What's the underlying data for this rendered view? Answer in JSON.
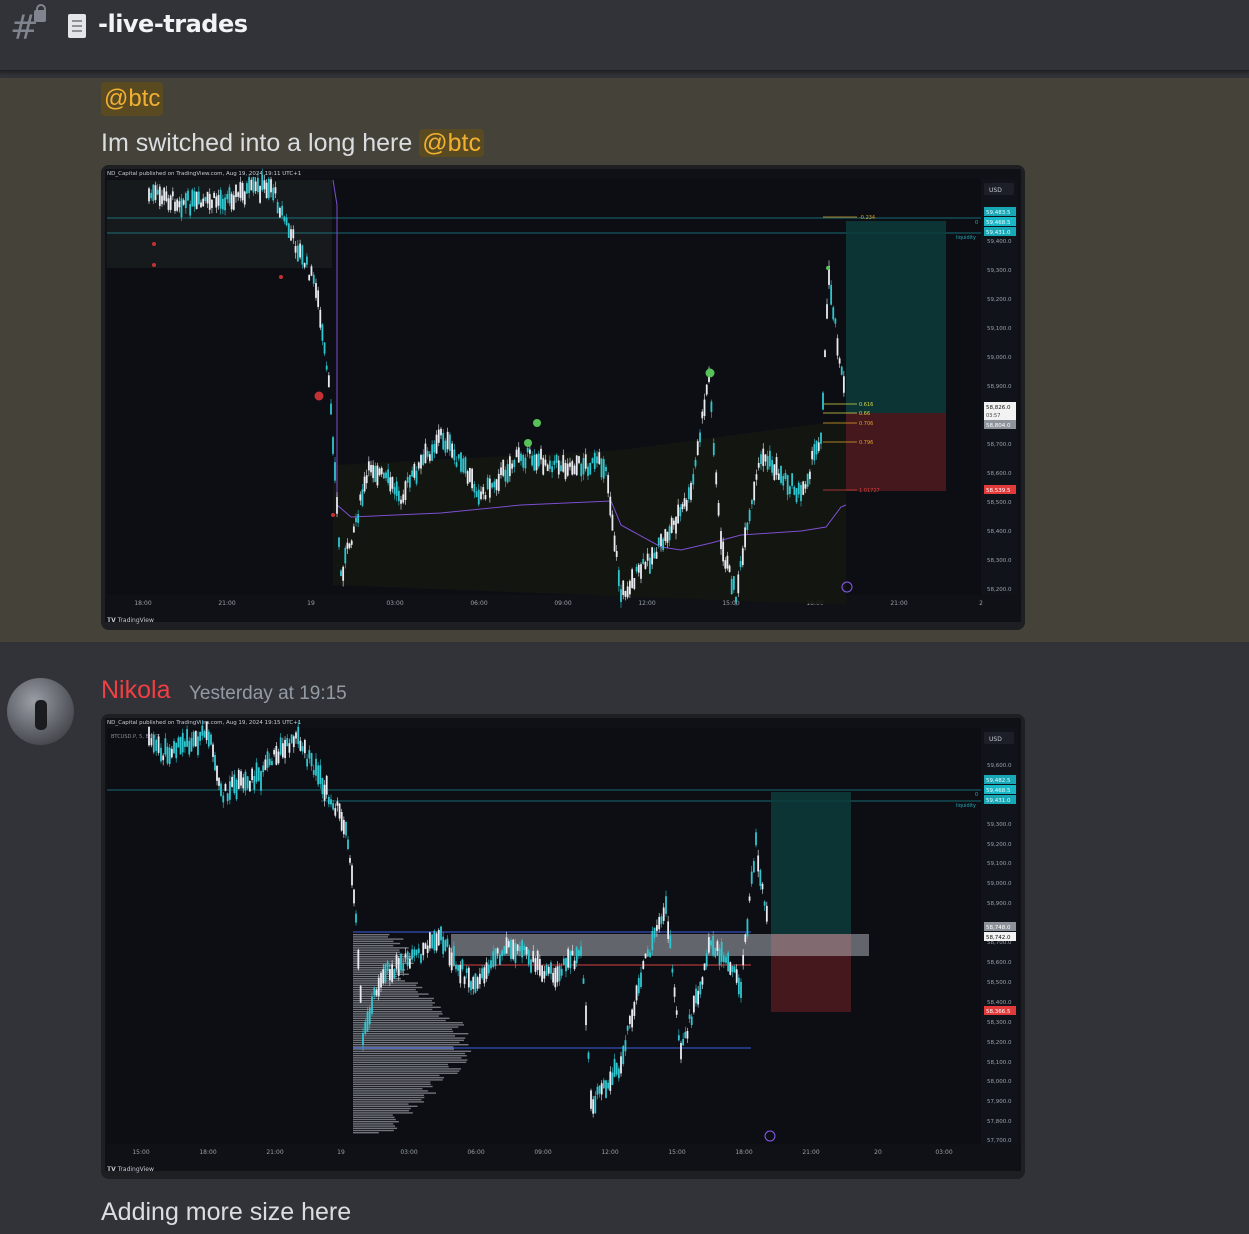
{
  "channel": {
    "name": "-live-trades",
    "hash_icon": "hash-lock-icon",
    "doc_icon": "document-icon"
  },
  "messages": [
    {
      "mention_line": "@btc",
      "text": "Im switched into a long here ",
      "inline_mention": "@btc",
      "highlight_color": "#45423a",
      "chart": {
        "publisher": "ND_Capital published on TradingView.com, Aug 19, 2024 19:11 UTC+1",
        "symbol": "BTCUSD.P, 5, BYBIT",
        "currency": "USD",
        "brand": "TradingView",
        "time_labels": [
          "18:00",
          "21:00",
          "19",
          "03:00",
          "06:00",
          "09:00",
          "12:00",
          "15:00",
          "18:00",
          "21:00",
          "2"
        ],
        "price_labels": [
          "59,400.0",
          "59,300.0",
          "59,200.0",
          "59,100.0",
          "59,000.0",
          "58,900.0",
          "58,700.0",
          "58,600.0",
          "58,500.0",
          "58,400.0",
          "58,300.0",
          "58,200.0"
        ],
        "price_tags": {
          "top1": "59,483.5",
          "top2": "59,468.5",
          "top3": "59,431.0",
          "current": "58,826.0",
          "countdown": "03:57",
          "below": "58,804.0",
          "stop": "58,539.5"
        },
        "liquidity_label": "liquidity",
        "zero_label": "0",
        "fib_levels": [
          "-0.234",
          "0.616",
          "0.66",
          "0.706",
          "0.796",
          "1.01727"
        ]
      }
    },
    {
      "author": "Nikola",
      "author_color": "#f23f43",
      "timestamp": "Yesterday at 19:15",
      "chart": {
        "publisher": "ND_Capital published on TradingView.com, Aug 19, 2024 19:15 UTC+1",
        "symbol": "BTCUSD.P, 5, BYBIT",
        "currency": "USD",
        "brand": "TradingView",
        "time_labels": [
          "15:00",
          "18:00",
          "21:00",
          "19",
          "03:00",
          "06:00",
          "09:00",
          "12:00",
          "15:00",
          "18:00",
          "21:00",
          "20",
          "03:00"
        ],
        "price_labels": [
          "59,600.0",
          "59,300.0",
          "59,200.0",
          "59,100.0",
          "59,000.0",
          "58,900.0",
          "58,700.0",
          "58,600.0",
          "58,500.0",
          "58,400.0",
          "58,300.0",
          "58,200.0",
          "58,100.0",
          "58,000.0",
          "57,900.0",
          "57,800.0",
          "57,700.0"
        ],
        "price_tags": {
          "top1": "59,482.5",
          "top2": "59,468.5",
          "top3": "59,431.0",
          "current1": "58,748.0",
          "current2": "58,742.0",
          "stop": "58,366.5"
        },
        "liquidity_label": "liquidity",
        "zero_label": "0"
      },
      "text": "Adding more size here"
    }
  ]
}
